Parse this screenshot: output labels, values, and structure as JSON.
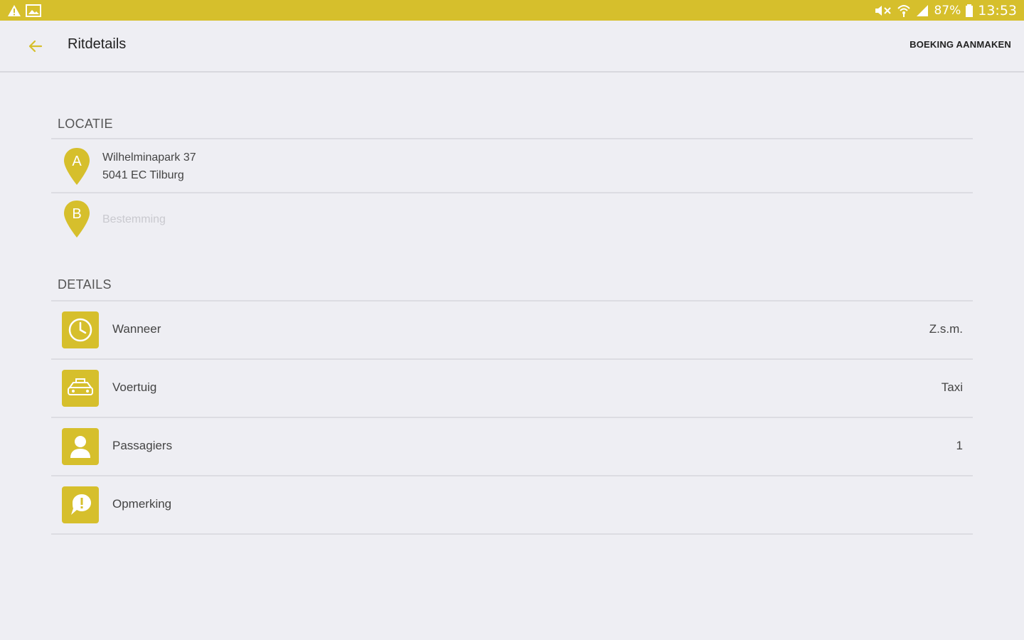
{
  "statusbar": {
    "battery": "87%",
    "time": "13:53"
  },
  "appbar": {
    "title": "Ritdetails",
    "action": "BOEKING AANMAKEN"
  },
  "location": {
    "header": "LOCATIE",
    "pickup": {
      "marker": "A",
      "line1": "Wilhelminapark 37",
      "line2": "5041 EC Tilburg"
    },
    "destination": {
      "marker": "B",
      "placeholder": "Bestemming"
    }
  },
  "details": {
    "header": "DETAILS",
    "rows": [
      {
        "icon": "clock-icon",
        "label": "Wanneer",
        "value": "Z.s.m."
      },
      {
        "icon": "car-icon",
        "label": "Voertuig",
        "value": "Taxi"
      },
      {
        "icon": "person-icon",
        "label": "Passagiers",
        "value": "1"
      },
      {
        "icon": "comment-icon",
        "label": "Opmerking",
        "value": ""
      }
    ]
  },
  "colors": {
    "accent": "#d6bf2c",
    "background": "#eeeef3"
  }
}
